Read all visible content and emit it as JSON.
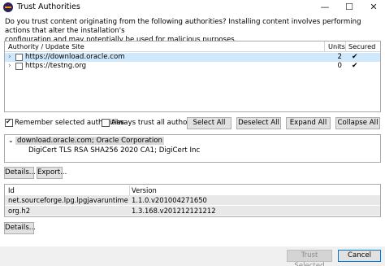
{
  "window": {
    "title": "Trust Authorities",
    "minimize": "—",
    "maximize": "☐",
    "close": "✕"
  },
  "prompt": {
    "line1": "Do you trust content originating from the following authorities?  Installing content involves performing actions that alter the installation's",
    "line2": "configuration and may potentially be used for malicious purposes."
  },
  "authorities_table": {
    "columns": [
      "Authority / Update Site",
      "Units",
      "Secured"
    ],
    "rows": [
      {
        "site": "https://download.oracle.com",
        "units": "2",
        "secured": "✔",
        "selected": true
      },
      {
        "site": "https://testng.org",
        "units": "0",
        "secured": "✔",
        "selected": false
      }
    ]
  },
  "options": {
    "remember": "Remember selected authorities",
    "always_trust": "Always trust all authorities"
  },
  "buttons": {
    "select_all": "Select All",
    "deselect_all": "Deselect All",
    "expand_all": "Expand All",
    "collapse_all": "Collapse All",
    "details": "Details...",
    "export": "Export...",
    "details2": "Details...",
    "trust_selected": "Trust Selected",
    "cancel": "Cancel"
  },
  "certificate_tree": {
    "root": "download.oracle.com; Oracle Corporation",
    "child": "DigiCert TLS RSA SHA256 2020 CA1; DigiCert Inc"
  },
  "units_table": {
    "columns": [
      "Id",
      "Version"
    ],
    "rows": [
      {
        "id": "net.sourceforge.lpg.lpgjavaruntime",
        "version": "1.1.0.v201004271650"
      },
      {
        "id": "org.h2",
        "version": "1.3.168.v201212121212"
      }
    ]
  },
  "icons": {
    "app": "eclipse-icon",
    "expand": "chevron-right-icon",
    "tree_toggle": "chevron-down-icon",
    "check": "checkmark-icon"
  }
}
